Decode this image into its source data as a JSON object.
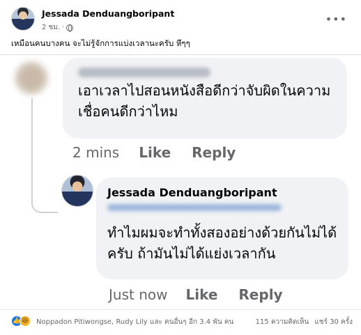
{
  "post": {
    "author": "Jessada Denduangboripant",
    "time": "2 ชม.",
    "text": "เหมือนคนบางคน จะไม่รู้จักการแบ่งเวลานะครับ หึๆๆ"
  },
  "comment1": {
    "text": "เอาเวลาไปสอนหนังสือดีกว่าจับผิดในความเชื่อคนดีกว่าไหม",
    "time": "2 mins",
    "like_label": "Like",
    "reply_label": "Reply"
  },
  "reply1": {
    "author": "Jessada Denduangboripant",
    "text": "ทำไมผมจะทำทั้งสองอย่างด้วยกันไม่ได้ครับ ถ้ามันไม่ได้แย่งเวลากัน",
    "time": "Just now",
    "like_label": "Like",
    "reply_label": "Reply"
  },
  "footer": {
    "reactors": "Noppadon Pitiwongse, Rudy Lily และ คนอื่นๆ อีก 3.4 พัน คน",
    "comments_count": "115 ความคิดเห็น",
    "shares_count": "แชร์ 30 ครั้ง"
  },
  "icons": {
    "privacy": "globe-icon",
    "menu": "more-icon",
    "reaction_primary": "like-icon",
    "reaction_secondary": "haha-icon"
  },
  "colors": {
    "accent": "#1877f2",
    "bubble": "#f0f2f5",
    "secondary_text": "#65676b"
  }
}
